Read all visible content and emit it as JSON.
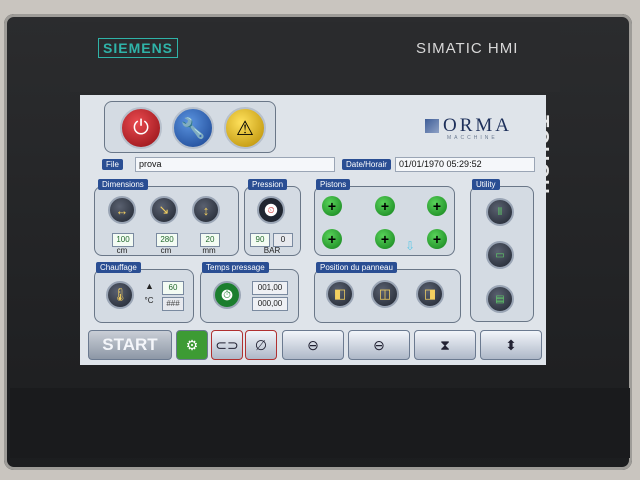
{
  "device": {
    "brand": "SIEMENS",
    "model": "SIMATIC HMI",
    "touch_label": "TOUCH"
  },
  "header": {
    "logo_text": "ORMA",
    "logo_subtext": "MACCHINE",
    "buttons": [
      {
        "name": "power",
        "icon": "power-icon",
        "color": "#c3222a"
      },
      {
        "name": "settings",
        "icon": "wrench-icon",
        "color": "#2d63b8"
      },
      {
        "name": "alarm",
        "icon": "warning-icon",
        "color": "#e6b400"
      }
    ]
  },
  "file": {
    "label": "File",
    "value": "prova"
  },
  "datetime": {
    "label": "Date/Horair",
    "value": "01/01/1970 05:29:52"
  },
  "dimensions": {
    "title": "Dimensions",
    "items": [
      {
        "value": "100",
        "unit": "cm"
      },
      {
        "value": "280",
        "unit": "cm"
      },
      {
        "value": "20",
        "unit": "mm"
      }
    ]
  },
  "pressure": {
    "title": "Pression",
    "value": "90",
    "value2": "0",
    "unit": "BAR"
  },
  "pistons": {
    "title": "Pistons",
    "symbol": "+"
  },
  "utility": {
    "title": "Utility"
  },
  "heating": {
    "title": "Chauffage",
    "setpoint": "60",
    "unit": "°C",
    "reading": "###"
  },
  "pressing_time": {
    "title": "Temps pressage",
    "value1": "001,00",
    "value2": "000,00"
  },
  "panel_position": {
    "title": "Position du panneau"
  },
  "bottom": {
    "start_label": "START"
  }
}
